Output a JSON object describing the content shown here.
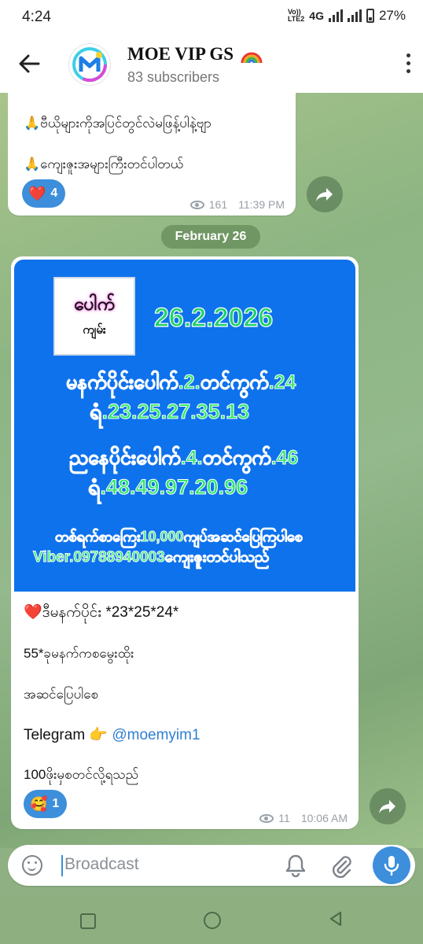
{
  "status_bar": {
    "time": "4:24",
    "network": "4G",
    "volte_top": "Vo))",
    "volte_bottom": "LTE2",
    "battery": "27%"
  },
  "header": {
    "title": "MOE VIP GS",
    "title_emoji": "rainbow-icon",
    "subtitle": "83 subscribers"
  },
  "messages": [
    {
      "lines": [
        "🙏ဗီယိုများကိုအပြင်တွင်လဲမဖြန့်ပါနဲ့ဗျာ",
        "🙏ကျေးဇူးအများကြီးတင်ပါတယ်"
      ],
      "reaction": {
        "emoji": "❤️",
        "count": "4"
      },
      "views": "161",
      "time": "11:39 PM"
    },
    {
      "poster": {
        "logo_line1": "ပေါက်",
        "logo_line2": "ကျမ်း",
        "date": "26.2.2026",
        "line1": "မနက်ပိုင်းပေါက်.2.တင်ကွက်.24",
        "line2": "ရံ.23.25.27.35.13",
        "line3": "ညနေပိုင်းပေါက်.4.တင်ကွက်.46",
        "line4": "ရံ.48.49.97.20.96",
        "line5": "တစ်ရက်စာကြေး10,000ကျပ်အဆင်ပြေကြပါစေ",
        "line6": "Viber.09788940003ကျေးဇူးတင်ပါသည်"
      },
      "lines": [
        "❤️ဒီမနက်ပိုင်း *23*25*24*",
        "55*ခုမနက်ကစမွေးထိုး",
        "အဆင်ပြေပါစေ",
        "Telegram 👉 ",
        "@moemyim1",
        "100ဖိုးမှစတင်လို့ရသည်"
      ],
      "reaction": {
        "emoji": "🥰",
        "count": "1"
      },
      "views": "11",
      "time": "10:06 AM"
    }
  ],
  "date_separator": "February 26",
  "input": {
    "placeholder": "Broadcast"
  },
  "colors": {
    "accent": "#3d8edb",
    "poster_bg": "#0e72ec",
    "neon_green": "#2ee86a",
    "wallpaper": "#8fb083"
  }
}
